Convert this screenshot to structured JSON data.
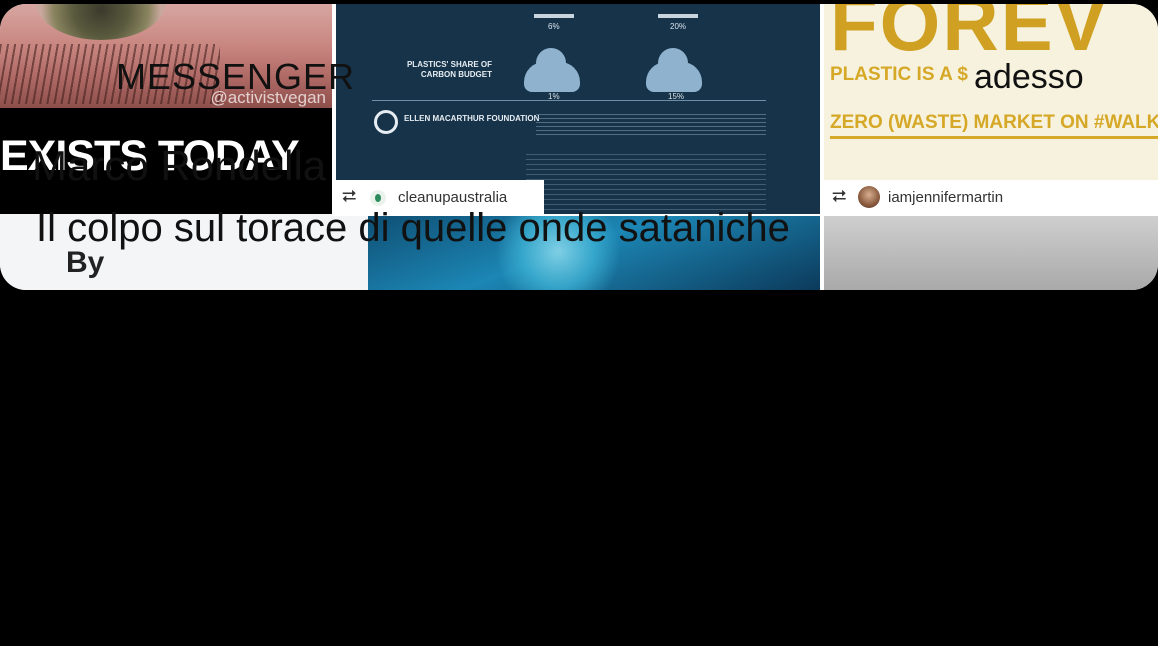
{
  "notification": {
    "app_name": "MESSENGER",
    "time": "adesso",
    "title": "Marco Rondella",
    "body": "Il colpo sul torace di quelle onde sataniche"
  },
  "thumbnail": {
    "tile1": {
      "handle": "@activistvegan",
      "headline": "EXISTS TODAY",
      "caption": "By"
    },
    "tile2": {
      "top_values": [
        "6%",
        "20%"
      ],
      "label": "PLASTICS' SHARE OF CARBON BUDGET",
      "values": [
        "1%",
        "15%"
      ],
      "foundation": "ELLEN MACARTHUR FOUNDATION",
      "repost_user": "cleanupaustralia"
    },
    "tile3": {
      "headline": "FOREV",
      "line1": "PLASTIC IS A $",
      "line2": "ZERO (WASTE) MARKET ON #WALKT",
      "repost_user": "iamjennifermartin"
    },
    "repost_icon": "repost-icon"
  },
  "colors": {
    "background": "#000000",
    "card": "#ffffff",
    "accent_gold": "#d6a827",
    "infographic_bg": "#173349"
  }
}
